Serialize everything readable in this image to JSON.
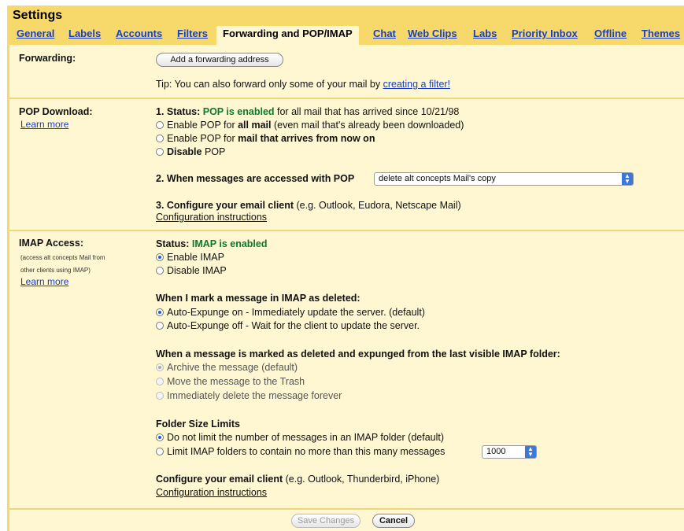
{
  "title": "Settings",
  "tabs": [
    {
      "label": "General"
    },
    {
      "label": "Labels"
    },
    {
      "label": "Accounts"
    },
    {
      "label": "Filters"
    },
    {
      "label": "Forwarding and POP/IMAP"
    },
    {
      "label": "Chat"
    },
    {
      "label": "Web Clips"
    },
    {
      "label": "Labs"
    },
    {
      "label": "Priority Inbox"
    },
    {
      "label": "Offline"
    },
    {
      "label": "Themes"
    }
  ],
  "forwarding": {
    "label": "Forwarding:",
    "add_button": "Add a forwarding address",
    "tip_prefix": "Tip: You can also forward only some of your mail by ",
    "tip_link": "creating a filter!"
  },
  "pop": {
    "label": "POP Download:",
    "learn_more": "Learn more",
    "status_prefix": "1. Status: ",
    "status_value": "POP is enabled",
    "status_suffix": " for all mail that has arrived since 10/21/98",
    "opt1_a": "Enable POP for ",
    "opt1_b": "all mail",
    "opt1_c": " (even mail that's already been downloaded)",
    "opt2_a": "Enable POP for ",
    "opt2_b": "mail that arrives from now on",
    "opt3_a": "Disable",
    "opt3_b": " POP",
    "access_label": "2. When messages are accessed with POP",
    "access_select": "delete alt concepts Mail's copy",
    "configure_a": "3. Configure your email client",
    "configure_b": " (e.g. Outlook, Eudora, Netscape Mail)",
    "config_link": "Configuration instructions"
  },
  "imap": {
    "label": "IMAP Access:",
    "note_line1": "(access alt concepts Mail from",
    "note_line2": "other clients using IMAP)",
    "learn_more": "Learn more",
    "status_prefix": "Status: ",
    "status_value": "IMAP is enabled",
    "enable": "Enable IMAP",
    "disable": "Disable IMAP",
    "deleted_heading": "When I mark a message in IMAP as deleted:",
    "expunge_on": "Auto-Expunge on - Immediately update the server. (default)",
    "expunge_off": "Auto-Expunge off - Wait for the client to update the server.",
    "expunged_heading": "When a message is marked as deleted and expunged from the last visible IMAP folder:",
    "archive": "Archive the message (default)",
    "trash": "Move the message to the Trash",
    "delete_forever": "Immediately delete the message forever",
    "folder_heading": "Folder Size Limits",
    "no_limit": "Do not limit the number of messages in an IMAP folder (default)",
    "limit": "Limit IMAP folders to contain no more than this many messages",
    "limit_select": "1000",
    "configure_a": "Configure your email client",
    "configure_b": " (e.g. Outlook, Thunderbird, iPhone)",
    "config_link": "Configuration instructions"
  },
  "footer": {
    "save": "Save Changes",
    "cancel": "Cancel"
  }
}
